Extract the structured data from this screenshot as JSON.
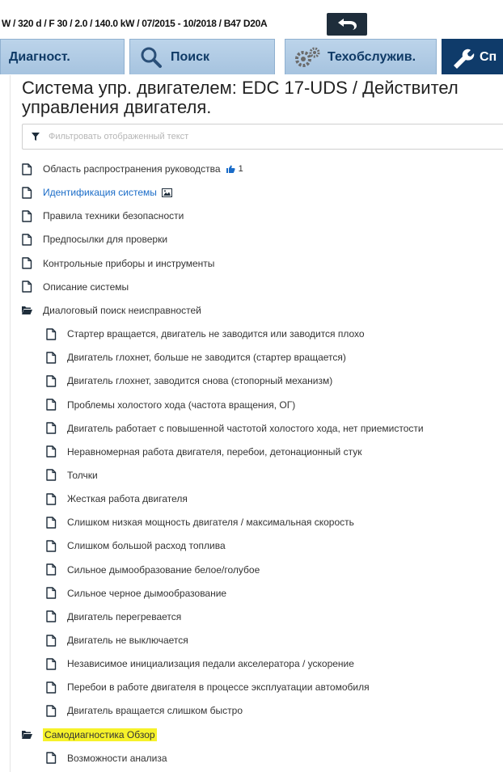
{
  "vehicle_bar": {
    "text": "W / 320 d / F 30 / 2.0 / 140.0 kW / 07/2015 - 10/2018 / B47 D20A",
    "back_icon": "back-arrow-icon"
  },
  "tabs": [
    {
      "label": "Диагност.",
      "icon": "",
      "active": false
    },
    {
      "label": "Поиск",
      "icon": "magnifier-icon",
      "active": false
    },
    {
      "label": "Техобслужив.",
      "icon": "gears-icon",
      "active": false
    },
    {
      "label": "Сп",
      "icon": "wrench-icon",
      "active": true
    }
  ],
  "title": {
    "line1": "Система упр. двигателем: EDC 17-UDS / Действител",
    "line2": "управления двигателя."
  },
  "filter": {
    "placeholder": "Фильтровать отображенный текст",
    "icon": "funnel-icon"
  },
  "tree": [
    {
      "label": "Область распространения руководства",
      "icon": "document-icon",
      "level": 0,
      "likes": "1"
    },
    {
      "label": "Идентификация системы",
      "icon": "document-icon",
      "level": 0,
      "link": true,
      "image": true
    },
    {
      "label": "Правила техники безопасности",
      "icon": "document-icon",
      "level": 0
    },
    {
      "label": "Предпосылки для проверки",
      "icon": "document-icon",
      "level": 0
    },
    {
      "label": "Контрольные приборы и инструменты",
      "icon": "document-icon",
      "level": 0
    },
    {
      "label": "Описание системы",
      "icon": "document-icon",
      "level": 0
    },
    {
      "label": "Диалоговый поиск неисправностей",
      "icon": "folder-open-icon",
      "level": 0
    },
    {
      "label": "Стартер вращается, двигатель не заводится или заводится плохо",
      "icon": "document-icon",
      "level": 1
    },
    {
      "label": "Двигатель глохнет, больше не заводится (стартер вращается)",
      "icon": "document-icon",
      "level": 1
    },
    {
      "label": "Двигатель глохнет, заводится снова (стопорный механизм)",
      "icon": "document-icon",
      "level": 1
    },
    {
      "label": "Проблемы холостого хода (частота вращения, ОГ)",
      "icon": "document-icon",
      "level": 1
    },
    {
      "label": "Двигатель работает с повышенной частотой холостого хода, нет приемистости",
      "icon": "document-icon",
      "level": 1
    },
    {
      "label": "Неравномерная работа двигателя, перебои, детонационный стук",
      "icon": "document-icon",
      "level": 1
    },
    {
      "label": "Толчки",
      "icon": "document-icon",
      "level": 1
    },
    {
      "label": "Жесткая работа двигателя",
      "icon": "document-icon",
      "level": 1
    },
    {
      "label": "Слишком низкая мощность двигателя / максимальная скорость",
      "icon": "document-icon",
      "level": 1
    },
    {
      "label": "Слишком большой расход топлива",
      "icon": "document-icon",
      "level": 1
    },
    {
      "label": "Сильное дымообразование белое/голубое",
      "icon": "document-icon",
      "level": 1
    },
    {
      "label": "Сильное черное дымообразование",
      "icon": "document-icon",
      "level": 1
    },
    {
      "label": "Двигатель перегревается",
      "icon": "document-icon",
      "level": 1
    },
    {
      "label": "Двигатель не выключается",
      "icon": "document-icon",
      "level": 1
    },
    {
      "label": "Независимое инициализация педали акселератора / ускорение",
      "icon": "document-icon",
      "level": 1
    },
    {
      "label": "Перебои в работе двигателя в процессе эксплуатации автомобиля",
      "icon": "document-icon",
      "level": 1
    },
    {
      "label": "Двигатель вращается слишком быстро",
      "icon": "document-icon",
      "level": 1
    },
    {
      "label": "Самодиагностика Обзор",
      "icon": "folder-open-icon",
      "level": 0,
      "highlight": true
    },
    {
      "label": "Возможности анализа",
      "icon": "document-icon",
      "level": 1
    }
  ],
  "colors": {
    "tab_bg": "#a6c3df",
    "tab_active_bg": "#0f3b6a",
    "link": "#1a6cc8",
    "highlight": "#f6f22a",
    "icon": "#1e2d3b"
  }
}
